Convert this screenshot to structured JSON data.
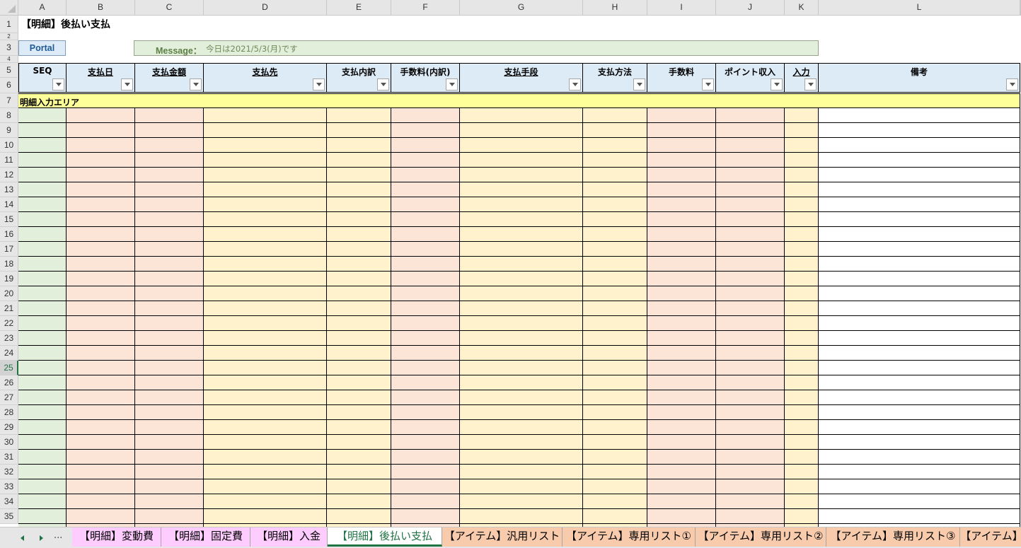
{
  "columns": [
    "A",
    "B",
    "C",
    "D",
    "E",
    "F",
    "G",
    "H",
    "I",
    "J",
    "K",
    "L"
  ],
  "rows_visible": [
    "1",
    "2",
    "3",
    "4",
    "5",
    "6",
    "7",
    "8",
    "9",
    "10",
    "11",
    "12",
    "13",
    "14",
    "15",
    "16",
    "17",
    "18",
    "19",
    "20",
    "21",
    "22",
    "23",
    "24",
    "25",
    "26",
    "27",
    "28",
    "29",
    "30",
    "31",
    "32",
    "33",
    "34",
    "35"
  ],
  "selected_row": "25",
  "sheet": {
    "title": "【明細】後払い支払",
    "portal_button": "Portal",
    "message_label": "Message：",
    "message_text": "今日は2021/5/3(月)です",
    "input_area_label": "明細入力エリア"
  },
  "headers": [
    {
      "label": "SEQ",
      "underline": false
    },
    {
      "label": "支払日",
      "underline": true
    },
    {
      "label": "支払金額",
      "underline": true
    },
    {
      "label": "支払先",
      "underline": true
    },
    {
      "label": "支払内訳",
      "underline": false
    },
    {
      "label": "手数料(内訳)",
      "underline": false
    },
    {
      "label": "支払手段",
      "underline": true
    },
    {
      "label": "支払方法",
      "underline": false
    },
    {
      "label": "手数料",
      "underline": false
    },
    {
      "label": "ポイント収入",
      "underline": false
    },
    {
      "label": "入力",
      "underline": true
    },
    {
      "label": "備考",
      "underline": false
    }
  ],
  "column_fill_colors": [
    "#e2efda",
    "#fce4d6",
    "#fce4d6",
    "#fff2cc",
    "#fff2cc",
    "#fce4d6",
    "#fff2cc",
    "#fff2cc",
    "#fce4d6",
    "#fce4d6",
    "#fff2cc",
    "#ffffff"
  ],
  "tabs": [
    {
      "label": "【明細】変動費",
      "color": "#ffccff",
      "active": false
    },
    {
      "label": "【明細】固定費",
      "color": "#ffccff",
      "active": false
    },
    {
      "label": "【明細】入金",
      "color": "#ffccff",
      "active": false
    },
    {
      "label": "【明細】後払い支払",
      "color": "#ffffff",
      "active": true
    },
    {
      "label": "【アイテム】汎用リスト",
      "color": "#f8cbad",
      "active": false
    },
    {
      "label": "【アイテム】専用リスト①",
      "color": "#f8cbad",
      "active": false
    },
    {
      "label": "【アイテム】専用リスト②",
      "color": "#f8cbad",
      "active": false
    },
    {
      "label": "【アイテム】専用リスト③",
      "color": "#f8cbad",
      "active": false
    },
    {
      "label": "【アイテム】",
      "color": "#f8cbad",
      "active": false
    }
  ],
  "tab_nav": {
    "ellipsis": "..."
  }
}
